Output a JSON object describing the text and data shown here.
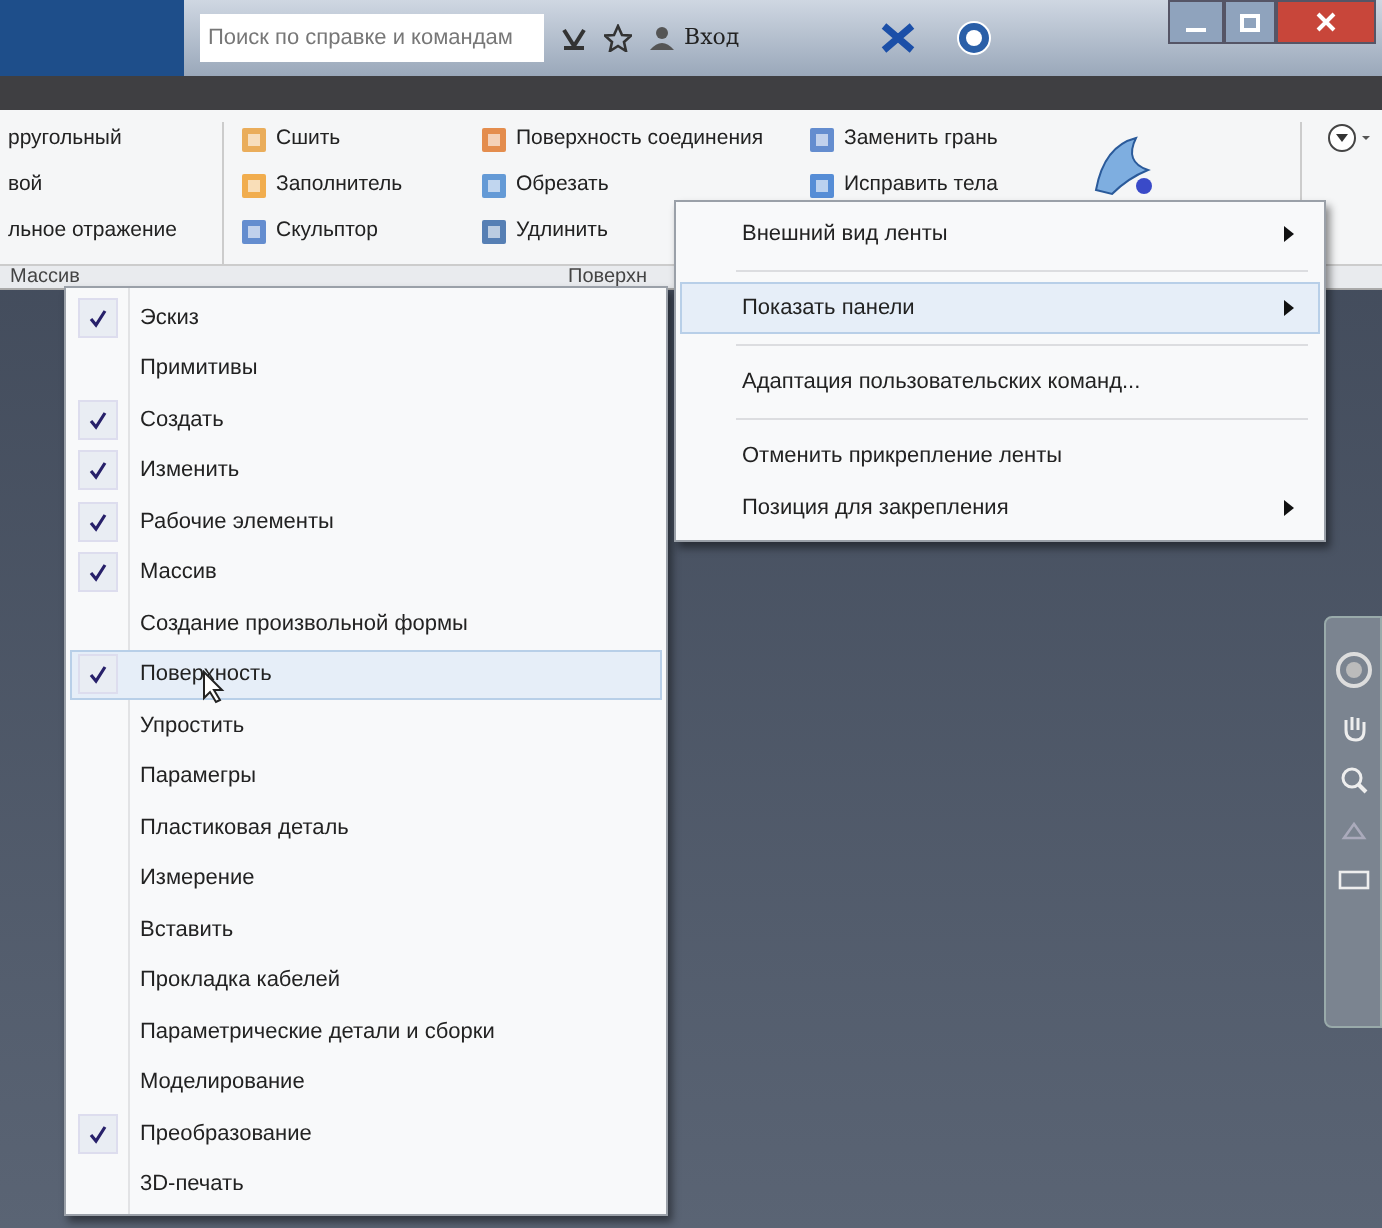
{
  "title_bar": {
    "search": {
      "placeholder": "Поиск по справке и командам"
    },
    "sign_in": "Вход"
  },
  "ribbon": {
    "columns": [
      {
        "items": [
          {
            "label": "рругольный",
            "kind": "none"
          },
          {
            "label": "вой",
            "kind": "none"
          },
          {
            "label": "льное отражение",
            "kind": "none"
          }
        ]
      },
      {
        "items": [
          {
            "label": "Сшить",
            "kind": "stitch"
          },
          {
            "label": "Заполнитель",
            "kind": "patch"
          },
          {
            "label": "Скульптор",
            "kind": "sculpt"
          }
        ]
      },
      {
        "items": [
          {
            "label": "Поверхность соединения",
            "kind": "boundary"
          },
          {
            "label": "Обрезать",
            "kind": "trim"
          },
          {
            "label": "Удлинить",
            "kind": "extend"
          }
        ]
      },
      {
        "items": [
          {
            "label": "Заменить грань",
            "kind": "replace"
          },
          {
            "label": "Исправить тела",
            "kind": "repair"
          }
        ]
      }
    ],
    "panel_labels": [
      "Массив",
      "Поверхн"
    ]
  },
  "panels_menu": [
    {
      "label": "Эскиз",
      "checked": true,
      "selected": false
    },
    {
      "label": "Примитивы",
      "checked": false,
      "selected": false
    },
    {
      "label": "Создать",
      "checked": true,
      "selected": false
    },
    {
      "label": "Изменить",
      "checked": true,
      "selected": false
    },
    {
      "label": "Рабочие элементы",
      "checked": true,
      "selected": false
    },
    {
      "label": "Массив",
      "checked": true,
      "selected": false
    },
    {
      "label": "Создание произвольной формы",
      "checked": false,
      "selected": false
    },
    {
      "label": "Поверхность",
      "checked": true,
      "selected": true
    },
    {
      "label": "Упростить",
      "checked": false,
      "selected": false
    },
    {
      "label": "Парамегры",
      "checked": false,
      "selected": false
    },
    {
      "label": "Пластиковая деталь",
      "checked": false,
      "selected": false
    },
    {
      "label": "Измерение",
      "checked": false,
      "selected": false
    },
    {
      "label": "Вставить",
      "checked": false,
      "selected": false
    },
    {
      "label": "Прокладка кабелей",
      "checked": false,
      "selected": false
    },
    {
      "label": "Параметрические детали и сборки",
      "checked": false,
      "selected": false
    },
    {
      "label": "Моделирование",
      "checked": false,
      "selected": false
    },
    {
      "label": "Преобразование",
      "checked": true,
      "selected": false
    },
    {
      "label": "3D-печать",
      "checked": false,
      "selected": false
    }
  ],
  "context_menu": [
    {
      "kind": "item",
      "label": "Внешний вид ленты",
      "submenu": true,
      "selected": false
    },
    {
      "kind": "separator"
    },
    {
      "kind": "item",
      "label": "Показать панели",
      "submenu": true,
      "selected": true
    },
    {
      "kind": "separator"
    },
    {
      "kind": "item",
      "label": "Адаптация пользовательских команд...",
      "submenu": false,
      "selected": false
    },
    {
      "kind": "separator"
    },
    {
      "kind": "item",
      "label": "Отменить прикрепление ленты",
      "submenu": false,
      "selected": false
    },
    {
      "kind": "item",
      "label": "Позиция для закрепления",
      "submenu": true,
      "selected": false
    }
  ]
}
